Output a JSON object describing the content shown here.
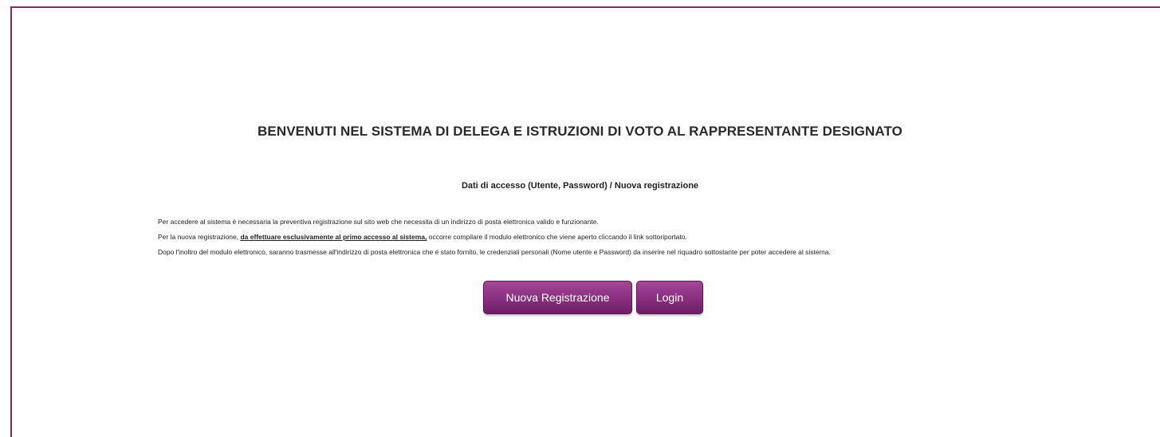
{
  "page": {
    "title": "BENVENUTI NEL SISTEMA DI DELEGA E ISTRUZIONI DI VOTO AL RAPPRESENTANTE DESIGNATO",
    "subtitle": "Dati di accesso (Utente, Password) / Nuova registrazione"
  },
  "info": {
    "line1": "Per accedere al sistema é necessaria la preventiva registrazione sul sito web che necessita di un indirizzo di posta elettronica valido e funzionante.",
    "line2_before": "Per la nuova registrazione, ",
    "line2_emphasis": "da effettuare esclusivamente al primo accesso al sistema,",
    "line2_after": " occorre compilare il modulo elettronico che viene aperto cliccando il link sottoriportato.",
    "line3": "Dopo l'inoltro del modulo elettronico, saranno trasmesse all'indirizzo di posta elettronica che é stato fornito, le credenziali personali (Nome utente e Password) da inserire nel riquadro sottostante per poter accedere al sistema."
  },
  "actions": {
    "register_label": "Nuova Registrazione",
    "login_label": "Login"
  },
  "colors": {
    "accent": "#8e3283",
    "border": "#7a2a6e"
  }
}
